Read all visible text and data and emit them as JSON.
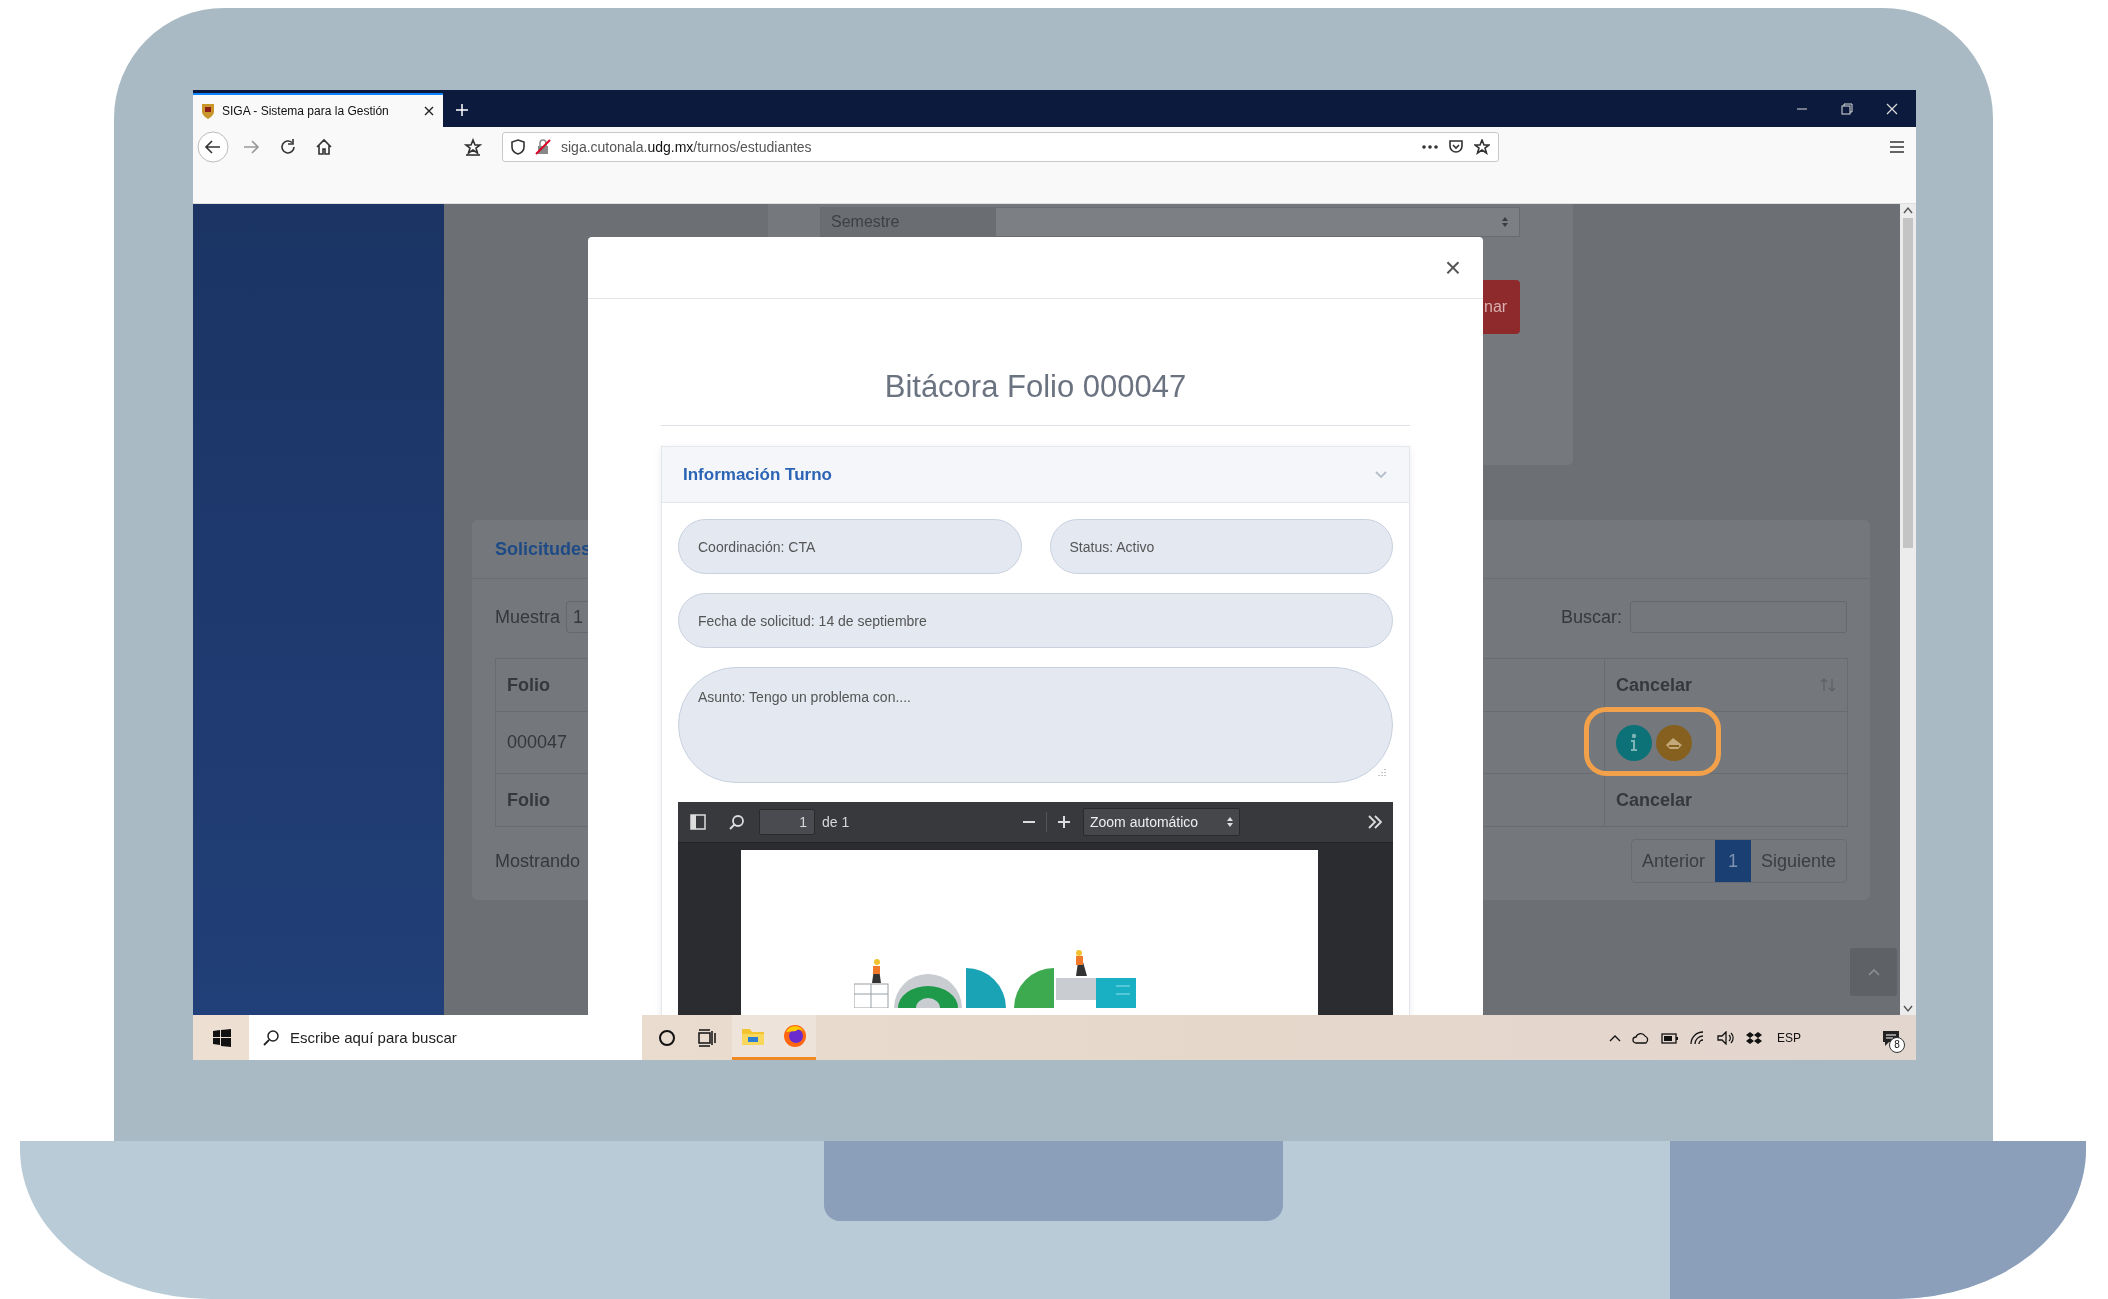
{
  "browser": {
    "tab": {
      "title": "SIGA - Sistema para la Gestión",
      "selected": true
    },
    "url": "siga.cutonala.**udg.mx**/turnos/estudiantes"
  },
  "page": {
    "filter_card": {
      "select_label": "Semestre",
      "button_label": "nar"
    },
    "requests_card": {
      "title": "Solicitudes",
      "length_label": "Muestra",
      "length_value": "1",
      "search_label": "Buscar:",
      "header": {
        "folio": "Folio",
        "cancel": "Cancelar"
      },
      "rows": [
        {
          "folio": "000047"
        }
      ],
      "footer": {
        "folio": "Folio",
        "cancel": "Cancelar"
      },
      "info": "Mostrando",
      "pagination": [
        {
          "label": "Anterior",
          "selected": false
        },
        {
          "label": "1",
          "selected": true
        },
        {
          "label": "Siguiente",
          "selected": false
        }
      ]
    }
  },
  "modal": {
    "close": "×",
    "title": "Bitácora Folio 000047",
    "section": {
      "title": "Información Turno",
      "expanded": true,
      "fields": [
        {
          "kind": "half",
          "text": "Coordinación: CTA"
        },
        {
          "kind": "half",
          "text": "Status: Activo"
        },
        {
          "kind": "full",
          "text": "Fecha de solicitud: 14 de septiembre"
        },
        {
          "kind": "area",
          "text": "Asunto: Tengo un problema con...."
        }
      ],
      "pdf_viewer": {
        "page": "1",
        "page_count": "de 1",
        "zoom": "Zoom automático"
      }
    }
  },
  "taskbar": {
    "search_placeholder": "Escribe aquí para buscar",
    "apps": [
      {
        "kind": "file-explorer",
        "running": true
      },
      {
        "kind": "firefox",
        "running": true
      }
    ],
    "language": "ESP",
    "notification_count": "8"
  }
}
